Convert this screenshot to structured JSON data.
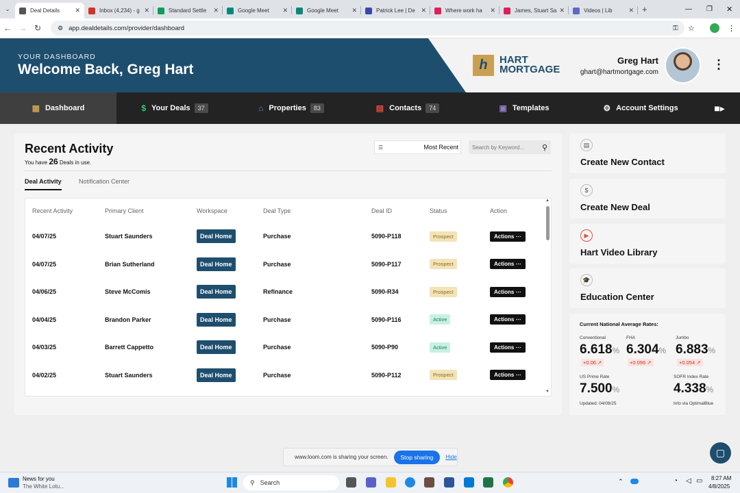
{
  "browser": {
    "tabs": [
      {
        "title": "Deal Details",
        "color": "#555"
      },
      {
        "title": "Inbox (4,234) - g",
        "color": "#d93025"
      },
      {
        "title": "Standard Settle",
        "color": "#0f9d58"
      },
      {
        "title": "Google Meet",
        "color": "#00897b"
      },
      {
        "title": "Google Meet",
        "color": "#00897b"
      },
      {
        "title": "Patrick Lee | De",
        "color": "#3949ab"
      },
      {
        "title": "Where work ha",
        "color": "#e01e5a"
      },
      {
        "title": "James, Stuart Sa",
        "color": "#e01e5a"
      },
      {
        "title": "Videos | Lib",
        "color": "#5c6bc0"
      }
    ],
    "url": "app.dealdetails.com/provider/dashboard"
  },
  "header": {
    "eyebrow": "YOUR DASHBOARD",
    "welcome": "Welcome Back, Greg Hart",
    "logo_mark": "h",
    "logo_line1": "HART",
    "logo_line2": "MORTGAGE",
    "user_name": "Greg Hart",
    "user_email": "ghart@hartmortgage.com"
  },
  "nav": {
    "dashboard": "Dashboard",
    "deals": "Your Deals",
    "deals_count": "37",
    "properties": "Properties",
    "properties_count": "83",
    "contacts": "Contacts",
    "contacts_count": "74",
    "templates": "Templates",
    "settings": "Account Settings"
  },
  "activity": {
    "title": "Recent Activity",
    "sub_prefix": "You have",
    "sub_count": "26",
    "sub_suffix": "Deals in use.",
    "sort": "Most Recent",
    "search_placeholder": "Search by Keyword...",
    "tab_deal": "Deal Activity",
    "tab_notif": "Notification Center",
    "columns": [
      "Recent Activity",
      "Primary Client",
      "Workspace",
      "Deal Type",
      "Deal ID",
      "Status",
      "Action"
    ],
    "rows": [
      {
        "date": "04/07/25",
        "client": "Stuart Saunders",
        "workspace": "Deal Home",
        "type": "Purchase",
        "id": "5090-P118",
        "status": "Prospect",
        "action": "Actions"
      },
      {
        "date": "04/07/25",
        "client": "Brian Sutherland",
        "workspace": "Deal Home",
        "type": "Purchase",
        "id": "5090-P117",
        "status": "Prospect",
        "action": "Actions"
      },
      {
        "date": "04/06/25",
        "client": "Steve McComis",
        "workspace": "Deal Home",
        "type": "Refinance",
        "id": "5090-R34",
        "status": "Prospect",
        "action": "Actions"
      },
      {
        "date": "04/04/25",
        "client": "Brandon Parker",
        "workspace": "Deal Home",
        "type": "Purchase",
        "id": "5090-P116",
        "status": "Active",
        "action": "Actions"
      },
      {
        "date": "04/03/25",
        "client": "Barrett Cappetto",
        "workspace": "Deal Home",
        "type": "Purchase",
        "id": "5090-P90",
        "status": "Active",
        "action": "Actions"
      },
      {
        "date": "04/02/25",
        "client": "Stuart Saunders",
        "workspace": "Deal Home",
        "type": "Purchase",
        "id": "5090-P112",
        "status": "Prospect",
        "action": "Actions"
      }
    ]
  },
  "cards": {
    "contact": "Create New Contact",
    "deal": "Create New Deal",
    "video": "Hart Video Library",
    "education": "Education Center"
  },
  "rates": {
    "title": "Current National Average Rates:",
    "conventional_label": "Conventional",
    "conventional": "6.618",
    "conventional_chg": "+0.06 ↗",
    "fha_label": "FHA",
    "fha": "6.304",
    "fha_chg": "+0.096 ↗",
    "jumbo_label": "Jumbo",
    "jumbo": "6.883",
    "jumbo_chg": "+0.054 ↗",
    "prime_label": "US Prime Rate",
    "prime": "7.500",
    "sofr_label": "SOFR Index Rate",
    "sofr": "4.338",
    "percent": "%",
    "updated": "Updated: 04/08/25",
    "source": "Info via OptimalBlue"
  },
  "loom": {
    "text": "www.loom.com is sharing your screen.",
    "stop": "Stop sharing",
    "hide": "Hide"
  },
  "taskbar": {
    "news_title": "News for you",
    "news_sub": "The White Lotu...",
    "search": "Search",
    "time": "8:27 AM",
    "date": "4/8/2025"
  }
}
